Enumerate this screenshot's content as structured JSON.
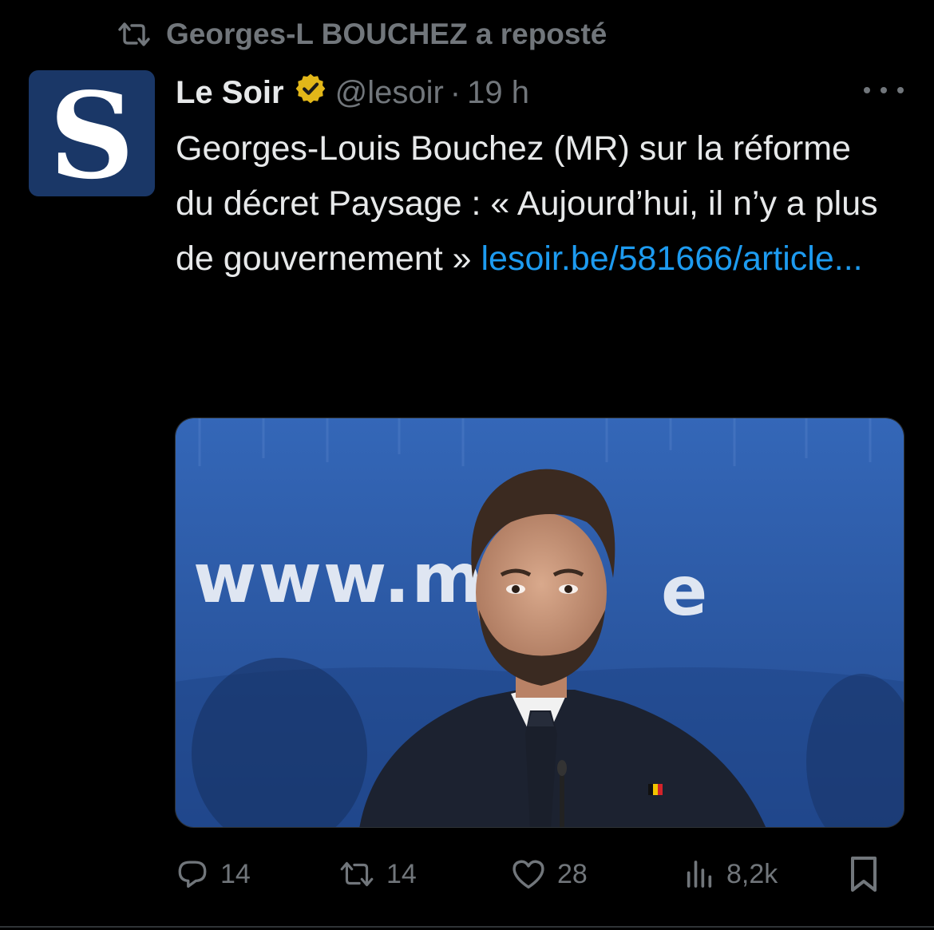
{
  "repost_banner": {
    "text": "Georges-L BOUCHEZ a reposté",
    "icon": "repost-icon"
  },
  "author": {
    "avatar_letter": "S",
    "display_name": "Le Soir",
    "verified_icon": "verified-badge-icon",
    "handle": "@lesoir",
    "separator": "·",
    "time": "19 h"
  },
  "tweet": {
    "text": "Georges-Louis Bouchez (MR) sur la réforme du décret Paysage : « Aujourd’hui, il n’y a plus de gouvernement » ",
    "link": "lesoir.be/581666/article..."
  },
  "media": {
    "backdrop_text": "www.m",
    "backdrop_text_tail": "e"
  },
  "actions": {
    "reply": {
      "icon": "reply-icon",
      "count": "14"
    },
    "repost": {
      "icon": "repost-icon",
      "count": "14"
    },
    "like": {
      "icon": "heart-icon",
      "count": "28"
    },
    "views": {
      "icon": "views-icon",
      "count": "8,2k"
    },
    "bookmark": {
      "icon": "bookmark-icon"
    }
  },
  "colors": {
    "background": "#000000",
    "text": "#e7e9ea",
    "muted": "#71767b",
    "link": "#1d9bf0",
    "verified": "#e2b719",
    "avatar_bg": "#1a3767",
    "photo_blue": "#2f5aa6"
  }
}
